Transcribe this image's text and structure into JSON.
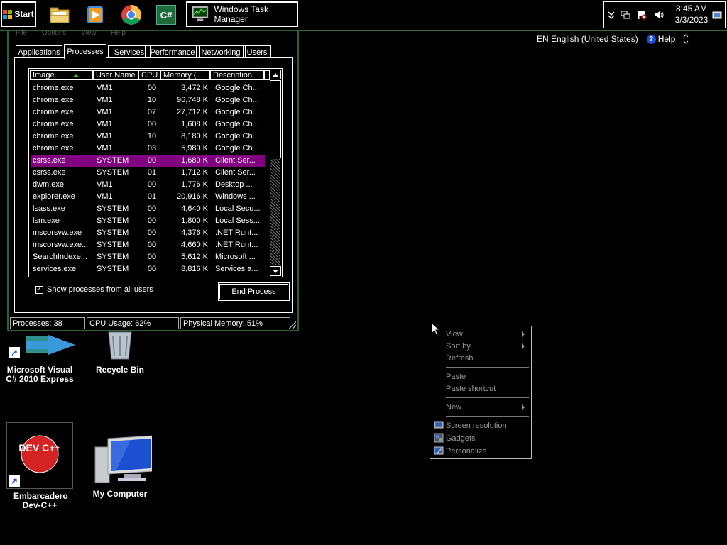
{
  "taskbar": {
    "start_label": "Start",
    "pinned": [
      {
        "name": "file-explorer-icon"
      },
      {
        "name": "media-player-icon"
      },
      {
        "name": "chrome-icon"
      },
      {
        "name": "csharp-icon",
        "glyph": "C#"
      }
    ],
    "active_task": {
      "label": "Windows Task Manager"
    },
    "clock": {
      "time": "8:45 AM",
      "date": "3/3/2023"
    }
  },
  "language_bar": {
    "language": "EN English (United States)",
    "help_label": "Help",
    "help_glyph": "?"
  },
  "task_manager": {
    "menu": "File Options View Help",
    "tabs": [
      "Applications",
      "Processes",
      "Services",
      "Performance",
      "Networking",
      "Users"
    ],
    "active_tab": "Processes",
    "columns": [
      "Image ...",
      "User Name",
      "CPU",
      "Memory (...",
      "Description"
    ],
    "rows": [
      {
        "image": "chrome.exe",
        "user": "VM1",
        "cpu": "00",
        "memory": "3,472 K",
        "desc": "Google Ch..."
      },
      {
        "image": "chrome.exe",
        "user": "VM1",
        "cpu": "10",
        "memory": "96,748 K",
        "desc": "Google Ch..."
      },
      {
        "image": "chrome.exe",
        "user": "VM1",
        "cpu": "07",
        "memory": "27,712 K",
        "desc": "Google Ch..."
      },
      {
        "image": "chrome.exe",
        "user": "VM1",
        "cpu": "00",
        "memory": "1,608 K",
        "desc": "Google Ch..."
      },
      {
        "image": "chrome.exe",
        "user": "VM1",
        "cpu": "10",
        "memory": "8,180 K",
        "desc": "Google Ch..."
      },
      {
        "image": "chrome.exe",
        "user": "VM1",
        "cpu": "03",
        "memory": "5,980 K",
        "desc": "Google Ch..."
      },
      {
        "image": "csrss.exe",
        "user": "SYSTEM",
        "cpu": "00",
        "memory": "1,680 K",
        "desc": "Client Ser...",
        "selected": true
      },
      {
        "image": "csrss.exe",
        "user": "SYSTEM",
        "cpu": "01",
        "memory": "1,712 K",
        "desc": "Client Ser..."
      },
      {
        "image": "dwm.exe",
        "user": "VM1",
        "cpu": "00",
        "memory": "1,776 K",
        "desc": "Desktop ..."
      },
      {
        "image": "explorer.exe",
        "user": "VM1",
        "cpu": "01",
        "memory": "20,916 K",
        "desc": "Windows ..."
      },
      {
        "image": "lsass.exe",
        "user": "SYSTEM",
        "cpu": "00",
        "memory": "4,640 K",
        "desc": "Local Secu..."
      },
      {
        "image": "lsm.exe",
        "user": "SYSTEM",
        "cpu": "00",
        "memory": "1,800 K",
        "desc": "Local Sess..."
      },
      {
        "image": "mscorsvw.exe",
        "user": "SYSTEM",
        "cpu": "00",
        "memory": "4,376 K",
        "desc": ".NET Runt..."
      },
      {
        "image": "mscorsvw.exe...",
        "user": "SYSTEM",
        "cpu": "00",
        "memory": "4,660 K",
        "desc": ".NET Runt..."
      },
      {
        "image": "SearchIndexe...",
        "user": "SYSTEM",
        "cpu": "00",
        "memory": "5,612 K",
        "desc": "Microsoft ..."
      },
      {
        "image": "services.exe",
        "user": "SYSTEM",
        "cpu": "00",
        "memory": "8,816 K",
        "desc": "Services a..."
      }
    ],
    "show_all_label": "Show processes from all users",
    "show_all_checked": "✓",
    "end_process_label": "End Process",
    "status": {
      "processes": "Processes: 38",
      "cpu": "CPU Usage: 62%",
      "memory": "Physical Memory: 51%"
    },
    "selected_color": "#800080"
  },
  "desktop_icons": [
    {
      "label": "Microsoft Visual C# 2010 Express"
    },
    {
      "label": "Recycle Bin"
    },
    {
      "label": "Embarcadero Dev-C++",
      "logo_text": "DEV C++"
    },
    {
      "label": "My Computer"
    }
  ],
  "context_menu": {
    "items": [
      {
        "label": "View",
        "submenu": true
      },
      {
        "label": "Sort by",
        "submenu": true
      },
      {
        "label": "Refresh"
      },
      {
        "label": "Paste"
      },
      {
        "label": "Paste shortcut"
      },
      {
        "label": "New",
        "submenu": true
      },
      {
        "label": "Screen resolution",
        "icon": "screen-resolution-icon"
      },
      {
        "label": "Gadgets",
        "icon": "gadgets-icon"
      },
      {
        "label": "Personalize",
        "icon": "personalize-icon"
      }
    ]
  }
}
